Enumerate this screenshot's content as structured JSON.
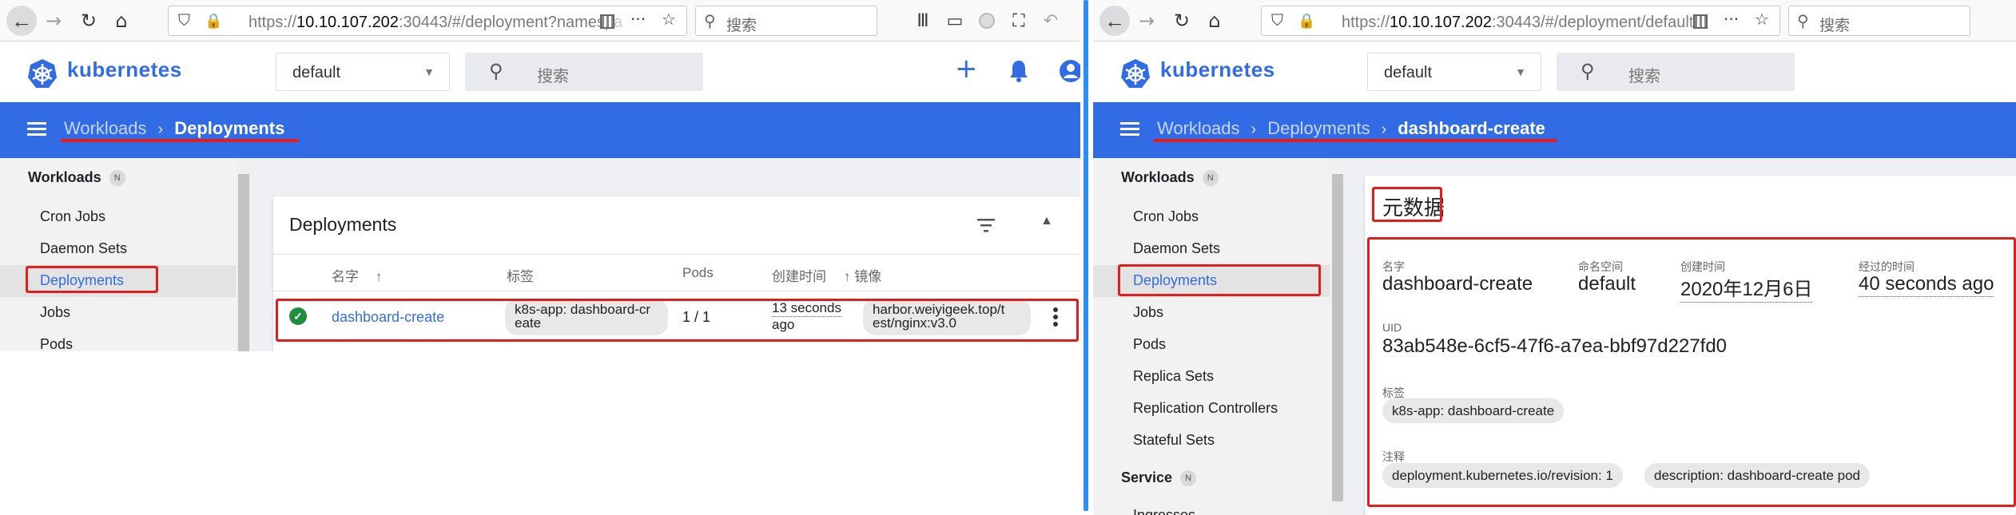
{
  "left": {
    "browser": {
      "back": "←",
      "forward": "→",
      "reload": "↻",
      "home": "⌂",
      "url_scheme": "https://",
      "url_host": "10.10.107.202",
      "url_rest": ":30443/#/deployment?namespa",
      "more": "···",
      "star": "☆",
      "search_placeholder": "搜索",
      "toolbar_icons": [
        "library-icon",
        "sidebar-icon",
        "extension-icon",
        "screenshot-icon",
        "undo-icon"
      ]
    },
    "header": {
      "logo_text": "kubernetes",
      "namespace": "default",
      "search_placeholder": "搜索",
      "plus": "+",
      "bell": "🔔",
      "account": "●"
    },
    "breadcrumb": {
      "items": [
        "Workloads",
        "Deployments"
      ]
    },
    "sidebar": {
      "section": "Workloads",
      "badge": "N",
      "items": [
        "Cron Jobs",
        "Daemon Sets",
        "Deployments",
        "Jobs",
        "Pods"
      ]
    },
    "card": {
      "title": "Deployments",
      "columns": [
        "名字",
        "标签",
        "Pods",
        "创建时间",
        "镜像"
      ],
      "row": {
        "name": "dashboard-create",
        "label_line1": "k8s-app: dashboard-cr",
        "label_line2": "eate",
        "pods": "1 / 1",
        "created_line1": "13 seconds",
        "created_line2": "ago",
        "image_line1": "harbor.weiyigeek.top/t",
        "image_line2": "est/nginx:v3.0"
      }
    }
  },
  "right": {
    "browser": {
      "url_scheme": "https://",
      "url_host": "10.10.107.202",
      "url_rest": ":30443/#/deployment/default/d",
      "search_placeholder": "搜索"
    },
    "header": {
      "logo_text": "kubernetes",
      "namespace": "default",
      "search_placeholder": "搜索"
    },
    "breadcrumb": {
      "items": [
        "Workloads",
        "Deployments",
        "dashboard-create"
      ]
    },
    "sidebar": {
      "section": "Workloads",
      "badge": "N",
      "items": [
        "Cron Jobs",
        "Daemon Sets",
        "Deployments",
        "Jobs",
        "Pods",
        "Replica Sets",
        "Replication Controllers",
        "Stateful Sets"
      ],
      "section2": "Service",
      "badge2": "N",
      "cut_item": "Ingresses"
    },
    "detail": {
      "title": "元数据",
      "name_label": "名字",
      "name": "dashboard-create",
      "namespace_label": "命名空间",
      "namespace": "default",
      "created_label": "创建时间",
      "created": "2020年12月6日",
      "age_label": "经过的时间",
      "age": "40 seconds ago",
      "uid_label": "UID",
      "uid": "83ab548e-6cf5-47f6-a7ea-bbf97d227fd0",
      "labels_label": "标签",
      "label_chip": "k8s-app: dashboard-create",
      "annotations_label": "注释",
      "annotation_chips": [
        "deployment.kubernetes.io/revision: 1",
        "description: dashboard-create pod"
      ]
    }
  },
  "colors": {
    "k8s_blue": "#326ce5",
    "highlight_red": "#e31c1c",
    "status_green": "#1e8e3e",
    "divider_blue": "#2b8ef3"
  }
}
